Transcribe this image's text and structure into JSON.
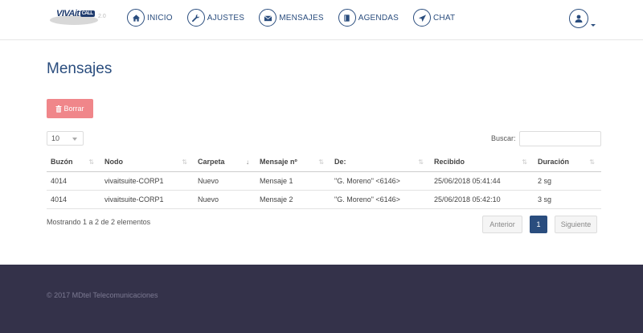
{
  "brand": {
    "logo_text": "VIVAit",
    "logo_call": "CALL",
    "logo_sub": "2.0"
  },
  "nav": {
    "items": [
      {
        "label": "INICIO",
        "icon": "home-icon"
      },
      {
        "label": "AJUSTES",
        "icon": "wrench-icon"
      },
      {
        "label": "MENSAJES",
        "icon": "envelope-icon"
      },
      {
        "label": "AGENDAS",
        "icon": "book-icon"
      },
      {
        "label": "CHAT",
        "icon": "send-icon"
      }
    ],
    "user_icon": "user-icon"
  },
  "page": {
    "title": "Mensajes"
  },
  "toolbar": {
    "delete_label": "Borrar",
    "delete_icon": "trash-icon"
  },
  "table_controls": {
    "page_size": "10",
    "search_label": "Buscar:",
    "search_value": ""
  },
  "table": {
    "columns": [
      "Buzón",
      "Nodo",
      "Carpeta",
      "Mensaje nº",
      "De:",
      "Recibido",
      "Duración"
    ],
    "rows": [
      [
        "4014",
        "vivaitsuite-CORP1",
        "Nuevo",
        "Mensaje 1",
        "\"G. Moreno\" <6146>",
        "25/06/2018 05:41:44",
        "2 sg"
      ],
      [
        "4014",
        "vivaitsuite-CORP1",
        "Nuevo",
        "Mensaje 2",
        "\"G. Moreno\" <6146>",
        "25/06/2018 05:42:10",
        "3 sg"
      ]
    ]
  },
  "info": "Mostrando 1 a 2 de 2 elementos",
  "pagination": {
    "prev": "Anterior",
    "current": "1",
    "next": "Siguiente"
  },
  "footer": {
    "text": "© 2017 MDtel Telecomunicaciones"
  },
  "colors": {
    "primary": "#2a4d7e",
    "danger": "#f0868a",
    "footer_bg": "#34324a"
  }
}
